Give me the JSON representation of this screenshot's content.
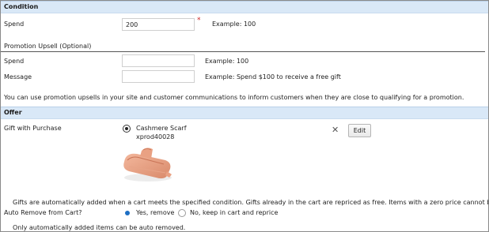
{
  "condition": {
    "header": "Condition",
    "spend_label": "Spend",
    "spend_value": "200",
    "required_mark": "*",
    "spend_example": "Example: 100"
  },
  "upsell": {
    "header": "Promotion Upsell (Optional)",
    "spend_label": "Spend",
    "spend_value": "",
    "spend_example": "Example: 100",
    "message_label": "Message",
    "message_value": "",
    "message_example": "Example: Spend $100 to receive a free gift",
    "info": "You can use promotion upsells in your site and customer communications to inform customers when they are close to qualifying for a promotion."
  },
  "offer": {
    "header": "Offer",
    "gift_label": "Gift with Purchase",
    "product_name": "Cashmere Scarf",
    "product_sku": "xprod40028",
    "edit_label": "Edit",
    "remove_icon": "close-icon",
    "gifts_note": "Gifts are automatically added when a cart meets the specified condition. Gifts already in the cart are repriced as free. Items with a zero price cannot be used as a gift with purchase.",
    "auto_remove_label": "Auto Remove from Cart?",
    "auto_remove_options": [
      "Yes, remove",
      "No, keep in cart and reprice"
    ],
    "auto_remove_selected": "Yes, remove",
    "auto_remove_note": "Only automatically added items can be auto removed."
  },
  "colors": {
    "section_band": "#d9e8f7",
    "radio_selected": "#1e6fc4",
    "required": "#cc2222"
  }
}
